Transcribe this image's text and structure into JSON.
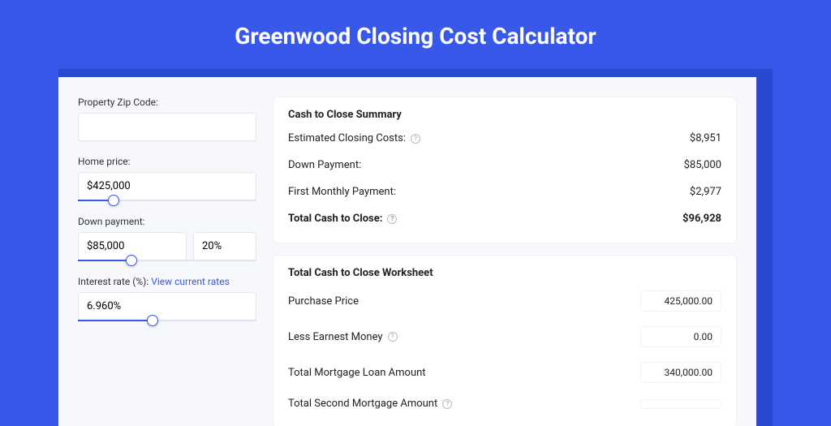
{
  "title": "Greenwood Closing Cost Calculator",
  "form": {
    "zip_label": "Property Zip Code:",
    "zip_value": "",
    "price_label": "Home price:",
    "price_value": "$425,000",
    "price_fill_pct": 20,
    "down_label": "Down payment:",
    "down_value": "$85,000",
    "down_pct_value": "20%",
    "down_fill_pct": 30,
    "rate_label": "Interest rate (%):",
    "rate_link": "View current rates",
    "rate_value": "6.960%",
    "rate_fill_pct": 42
  },
  "summary": {
    "title": "Cash to Close Summary",
    "rows": [
      {
        "label": "Estimated Closing Costs:",
        "value": "$8,951",
        "help": true
      },
      {
        "label": "Down Payment:",
        "value": "$85,000"
      },
      {
        "label": "First Monthly Payment:",
        "value": "$2,977"
      },
      {
        "label": "Total Cash to Close:",
        "value": "$96,928",
        "bold": true,
        "help": true
      }
    ]
  },
  "worksheet": {
    "title": "Total Cash to Close Worksheet",
    "rows": [
      {
        "label": "Purchase Price",
        "value": "425,000.00"
      },
      {
        "label": "Less Earnest Money",
        "value": "0.00",
        "help": true
      },
      {
        "label": "Total Mortgage Loan Amount",
        "value": "340,000.00"
      },
      {
        "label": "Total Second Mortgage Amount",
        "value": "",
        "help": true
      }
    ]
  }
}
